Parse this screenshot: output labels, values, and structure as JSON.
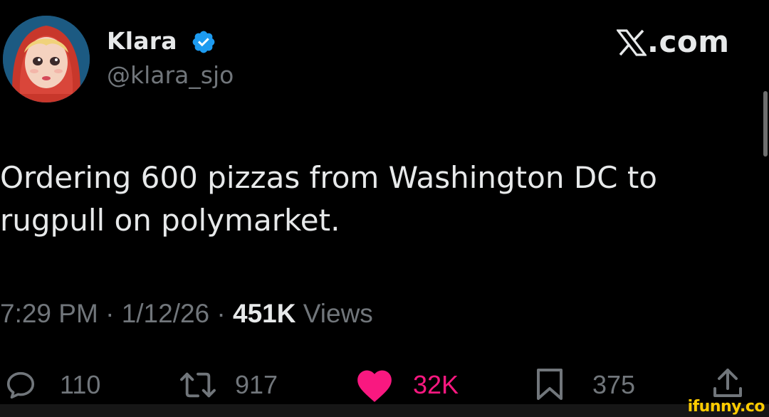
{
  "author": {
    "display_name": "Klara",
    "handle": "@klara_sjo",
    "verified_icon": "verified-badge-icon"
  },
  "brand": {
    "site_label": ".com",
    "logo_icon": "x-logo-icon"
  },
  "tweet": {
    "text": "Ordering 600 pizzas from Washington DC to rugpull on polymarket."
  },
  "meta": {
    "time": "7:29 PM",
    "separator": "·",
    "date": "1/12/26",
    "views_count": "451K",
    "views_label": "Views"
  },
  "actions": {
    "reply": {
      "icon": "reply-icon",
      "count": "110"
    },
    "repost": {
      "icon": "repost-icon",
      "count": "917"
    },
    "like": {
      "icon": "heart-icon",
      "count": "32K",
      "color": "#f91880"
    },
    "bookmark": {
      "icon": "bookmark-icon",
      "count": "375"
    },
    "share": {
      "icon": "share-icon"
    }
  },
  "watermark": "ifunny.co",
  "colors": {
    "background": "#000000",
    "text": "#e7e9ea",
    "secondary": "#71767b",
    "verified": "#1d9bf0",
    "like": "#f91880"
  }
}
